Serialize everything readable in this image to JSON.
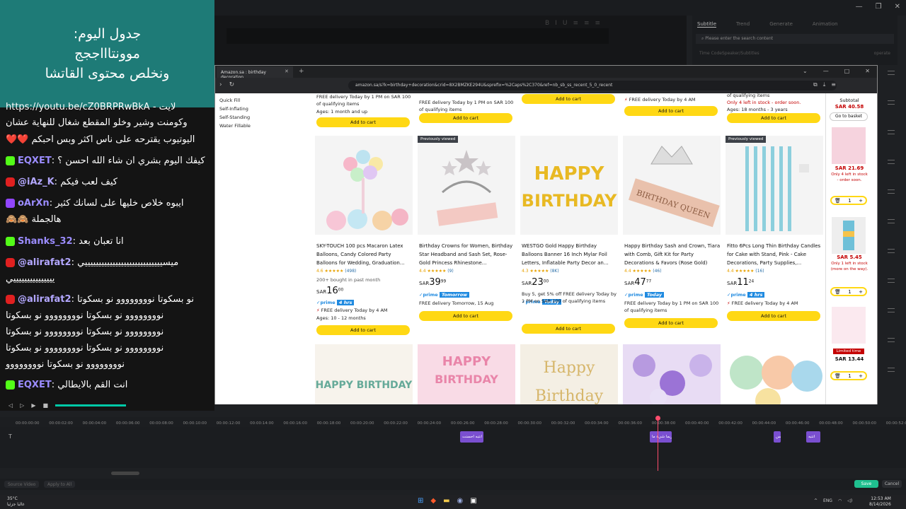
{
  "chat": {
    "header": [
      "جدول اليوم:",
      "موونتاااججج",
      "ونخلص محتوى القاتشا"
    ],
    "messages": [
      {
        "user": "",
        "text": "https://youtu.be/cZ0BRPRwBkA - لايت"
      },
      {
        "user": "",
        "text": "وكومنت وشير وخلو المقطع شغال للنهاية عشان"
      },
      {
        "user": "",
        "text": "اليوتيوب يقترحه على ناس اكثر وبس احبكم ❤️❤️"
      },
      {
        "user": "EQXET",
        "platform": "kick",
        "text": "كيفك اليوم بشري ان شاء الله احسن ؟"
      },
      {
        "user": "@iAz_K",
        "platform": "youtube",
        "text": "كيف لعب فيكم"
      },
      {
        "user": "oArXn",
        "platform": "twitch",
        "text": "ايبوه خلاص خليها على لسانك كثير"
      },
      {
        "user": "",
        "text": "هالجملة 🙈🙈"
      },
      {
        "user": "Shanks_32",
        "platform": "kick",
        "text": "انا تعبان بعد"
      },
      {
        "user": "@alirafat2",
        "platform": "youtube",
        "text": "ميسييييييييييييييييييييييييييييي"
      },
      {
        "user": "",
        "text": "يييييييييييييييي"
      },
      {
        "user": "@alirafat2",
        "platform": "youtube",
        "text": "نو بسكوتا نوووووووو نو بسكوتا"
      },
      {
        "user": "",
        "text": "نوووووووو نو بسكوتا نوووووووو نو بسكوتا"
      },
      {
        "user": "",
        "text": "نوووووووو نو بسكوتا نوووووووو نو بسكوتا"
      },
      {
        "user": "",
        "text": "نوووووووو نو بسكوتا نوووووووو نو بسكوتا"
      },
      {
        "user": "",
        "text": "نوووووووو نو بسكوتا نوووووووو"
      },
      {
        "user": "EQXET",
        "platform": "kick",
        "text": "انت القم بالايطالي"
      }
    ]
  },
  "editor": {
    "right_tabs": [
      "Subtitle",
      "Trend",
      "Generate",
      "Animation"
    ],
    "search_placeholder": "Please enter the search content",
    "col_time": "Time Code",
    "col_speaker": "Speaker/Subtitles",
    "col_op": "operate",
    "save": "Save",
    "cancel": "Cancel",
    "bottom_left": [
      "Source Video",
      "Apply to All"
    ]
  },
  "browser": {
    "tab_title": "Amazon.sa : birthday decoration",
    "url": "amazon.sa/s?k=birthday+decoration&crid=8X2BMZKE294U&sprefix=%2Caps%2C370&ref=nb_sb_ss_recent_5_0_recent",
    "filters": [
      "Quick Fill",
      "Self-Inflating",
      "Self-Standing",
      "Water Fillable"
    ],
    "top_row": [
      {
        "delivery": "FREE delivery Today by 1 PM on SAR 100 of qualifying items",
        "extra": "Ages: 1 month and up"
      },
      {
        "delivery": "FREE delivery Today by 1 PM on SAR 100 of qualifying items",
        "extra": ""
      },
      {
        "delivery": "",
        "extra": ""
      },
      {
        "delivery": "FREE delivery Today by 4 AM",
        "extra": ""
      },
      {
        "delivery": "of qualifying items",
        "extra": "Only 4 left in stock - order soon.",
        "extra2": "Ages: 18 months - 3 years"
      }
    ],
    "add_to_cart": "Add to cart",
    "previously_viewed": "Previously viewed",
    "products": [
      {
        "title": "SKY-TOUCH 100 pcs Macaron Latex Balloons, Candy Colored Party Balloons for Wedding, Graduation...",
        "rating": "4.6",
        "reviews": "(498)",
        "bought": "200+ bought in past month",
        "currency": "SAR",
        "price": "16",
        "cents": "00",
        "prime_tag": "4 hrs",
        "delivery": "FREE delivery Today by 4 AM",
        "extra": "Ages: 10 - 12 months",
        "prev": false
      },
      {
        "title": "Birthday Crowns for Women, Birthday Star Headband and Sash Set, Rose-Gold Princess Rhinestone...",
        "rating": "4.4",
        "reviews": "(9)",
        "bought": "",
        "currency": "SAR",
        "price": "39",
        "cents": "99",
        "prime_tag": "Tomorrow",
        "delivery": "FREE delivery Tomorrow, 15 Aug",
        "extra": "",
        "prev": true
      },
      {
        "title": "WESTGO Gold Happy Birthday Balloons Banner 16 Inch Mylar Foil Letters, Inflatable Party Decor an...",
        "rating": "4.3",
        "reviews": "(8K)",
        "bought": "",
        "currency": "SAR",
        "price": "23",
        "cents": "00",
        "prime_tag": "Today",
        "delivery": "Buy 5, get 5% off  FREE delivery Today by 1 PM on SAR 100 of qualifying items",
        "extra": "",
        "prev": false
      },
      {
        "title": "Happy Birthday Sash and Crown, Tiara with Comb, Gift Kit for Party Decorations & Favors (Rose Gold)",
        "rating": "4.4",
        "reviews": "(46)",
        "bought": "",
        "currency": "SAR",
        "price": "47",
        "cents": "77",
        "prime_tag": "Today",
        "delivery": "FREE delivery Today by 1 PM on SAR 100 of qualifying items",
        "extra": "",
        "prev": false
      },
      {
        "title": "Fitto 6Pcs Long Thin Birthday Candles for Cake with Stand, Pink - Cake Decorations, Party Supplies,...",
        "rating": "4.4",
        "reviews": "(16)",
        "bought": "",
        "currency": "SAR",
        "price": "11",
        "cents": "24",
        "prime_tag": "4 hrs",
        "delivery": "FREE delivery Today by 4 AM",
        "extra": "",
        "prev": true
      }
    ],
    "img_colors": [
      "#f3c7d8",
      "#f0e6ea",
      "#f6d75a",
      "#efd1c4",
      "#a9dde4"
    ],
    "row3_colors": [
      "#f7f3ec",
      "#f9dbe6",
      "#f4efe4",
      "#d9c5ef",
      "#cfe7c9"
    ],
    "subtotal": {
      "label": "Subtotal",
      "amount": "SAR 40.58",
      "go": "Go to basket",
      "items": [
        {
          "price": "SAR 21.69",
          "note": "Only 4 left in stock - order soon.",
          "qty": "1"
        },
        {
          "price": "SAR 5.45",
          "note": "Only 1 left in stock (more on the way).",
          "qty": "1"
        },
        {
          "price": "SAR 13.44",
          "note": "Limited time",
          "qty": "1"
        }
      ]
    }
  },
  "timeline": {
    "ticks": [
      "00:00:00:00",
      "00:00:02:00",
      "00:00:04:00",
      "00:00:06:00",
      "00:00:08:00",
      "00:00:10:00",
      "00:00:12:00",
      "00:00:14:00",
      "00:00:16:00",
      "00:00:18:00",
      "00:00:20:00",
      "00:00:22:00",
      "00:00:24:00",
      "00:00:26:00",
      "00:00:28:00",
      "00:00:30:00",
      "00:00:32:00",
      "00:00:34:00",
      "00:00:36:00",
      "00:00:38:00",
      "00:00:40:00",
      "00:00:42:00",
      "00:00:44:00",
      "00:00:46:00",
      "00:00:48:00",
      "00:00:50:00",
      "00:00:52:00"
    ],
    "clips": [
      "انتبه احسنت",
      "ربما شيء ما",
      "بس",
      "انتبه"
    ]
  },
  "taskbar": {
    "temp": "35°C",
    "weather": "غالبا جزئيا",
    "lang": "ENG",
    "time": "12:53 AM",
    "date": "8/14/2026"
  }
}
